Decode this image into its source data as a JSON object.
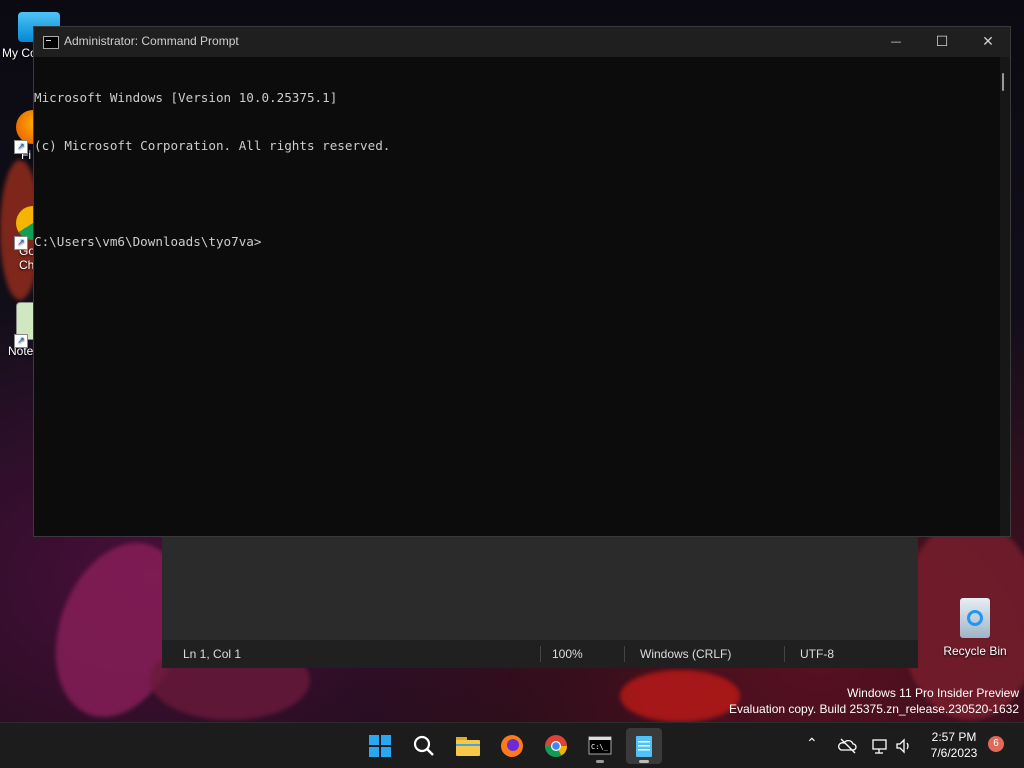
{
  "desktop": {
    "icons": [
      {
        "label": "My Co"
      },
      {
        "label": "Fi"
      },
      {
        "label": "Go\nChi"
      },
      {
        "label": "Note"
      }
    ],
    "recycle_bin_label": "Recycle Bin",
    "watermark": {
      "line1": "Windows 11 Pro Insider Preview",
      "line2": "Evaluation copy. Build 25375.zn_release.230520-1632"
    }
  },
  "cmd_window": {
    "title": "Administrator: Command Prompt",
    "lines": [
      "Microsoft Windows [Version 10.0.25375.1]",
      "(c) Microsoft Corporation. All rights reserved.",
      "",
      "C:\\Users\\vm6\\Downloads\\tyo7va>"
    ],
    "minimize_glyph": "—",
    "maximize_glyph": "☐",
    "close_glyph": "✕"
  },
  "notepad_status": {
    "position": "Ln 1, Col 1",
    "zoom": "100%",
    "line_ending": "Windows (CRLF)",
    "encoding": "UTF-8"
  },
  "taskbar": {
    "apps": [
      "start-icon",
      "search-icon",
      "file-explorer-icon",
      "firefox-icon",
      "chrome-icon",
      "terminal-icon",
      "notepad-icon"
    ],
    "clock_time": "2:57 PM",
    "clock_date": "7/6/2023",
    "notification_count": "6"
  },
  "colors": {
    "console_bg": "#0c0c0c",
    "console_text": "#cccccc",
    "taskbar_bg": "#1c1c1c",
    "notification_badge": "#e06a5a"
  }
}
